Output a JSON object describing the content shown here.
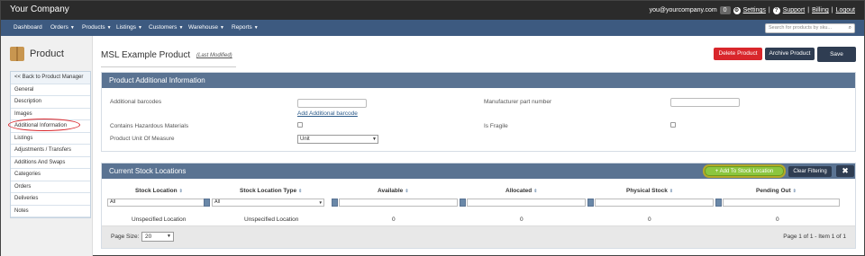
{
  "brand": "Your Company",
  "topbar": {
    "email": "you@yourcompany.com",
    "badge": "0",
    "settings": "Settings",
    "support": "Support",
    "billing": "Billing",
    "logout": "Logout",
    "sep1": "|",
    "sep2": "|",
    "sep3": "|"
  },
  "nav": {
    "items": [
      "Dashboard",
      "Orders",
      "Products",
      "Listings",
      "Customers",
      "Warehouse",
      "Reports"
    ],
    "search_placeholder": "Search for products by sku..."
  },
  "sidebar": {
    "title": "Product",
    "items": [
      "<< Back to Product Manager",
      "General",
      "Description",
      "Images",
      "Additional Information",
      "Listings",
      "Adjustments / Transfers",
      "Additions And Swaps",
      "Categories",
      "Orders",
      "Deliveries",
      "Notes"
    ]
  },
  "page": {
    "title": "MSL Example Product",
    "last_modified": "(Last Modified)",
    "delete_label": "Delete Product",
    "archive_label": "Archive Product",
    "save_label": "Save"
  },
  "info_panel": {
    "title": "Product Additional Information",
    "additional_barcodes": "Additional barcodes",
    "add_barcode_link": "Add Additional barcode",
    "hazardous": "Contains Hazardous Materials",
    "unit_of_measure": "Product Unit Of Measure",
    "unit_value": "Unit",
    "mpn": "Manufacturer part number",
    "fragile": "Is Fragile"
  },
  "stock_panel": {
    "title": "Current Stock Locations",
    "add_label": "+ Add To Stock Location",
    "clear_label": "Clear Filtering",
    "close_label": "✖",
    "columns": [
      "Stock Location",
      "Stock Location Type",
      "Available",
      "Allocated",
      "Physical Stock",
      "Pending Out"
    ],
    "filter_all_1": "All",
    "filter_all_2": "All",
    "row": [
      "Unspecified Location",
      "Unspecified Location",
      "0",
      "0",
      "0",
      "0"
    ],
    "page_size_label": "Page Size:",
    "page_size_value": "20",
    "paging": "Page 1 of 1 - Item 1 of 1"
  }
}
